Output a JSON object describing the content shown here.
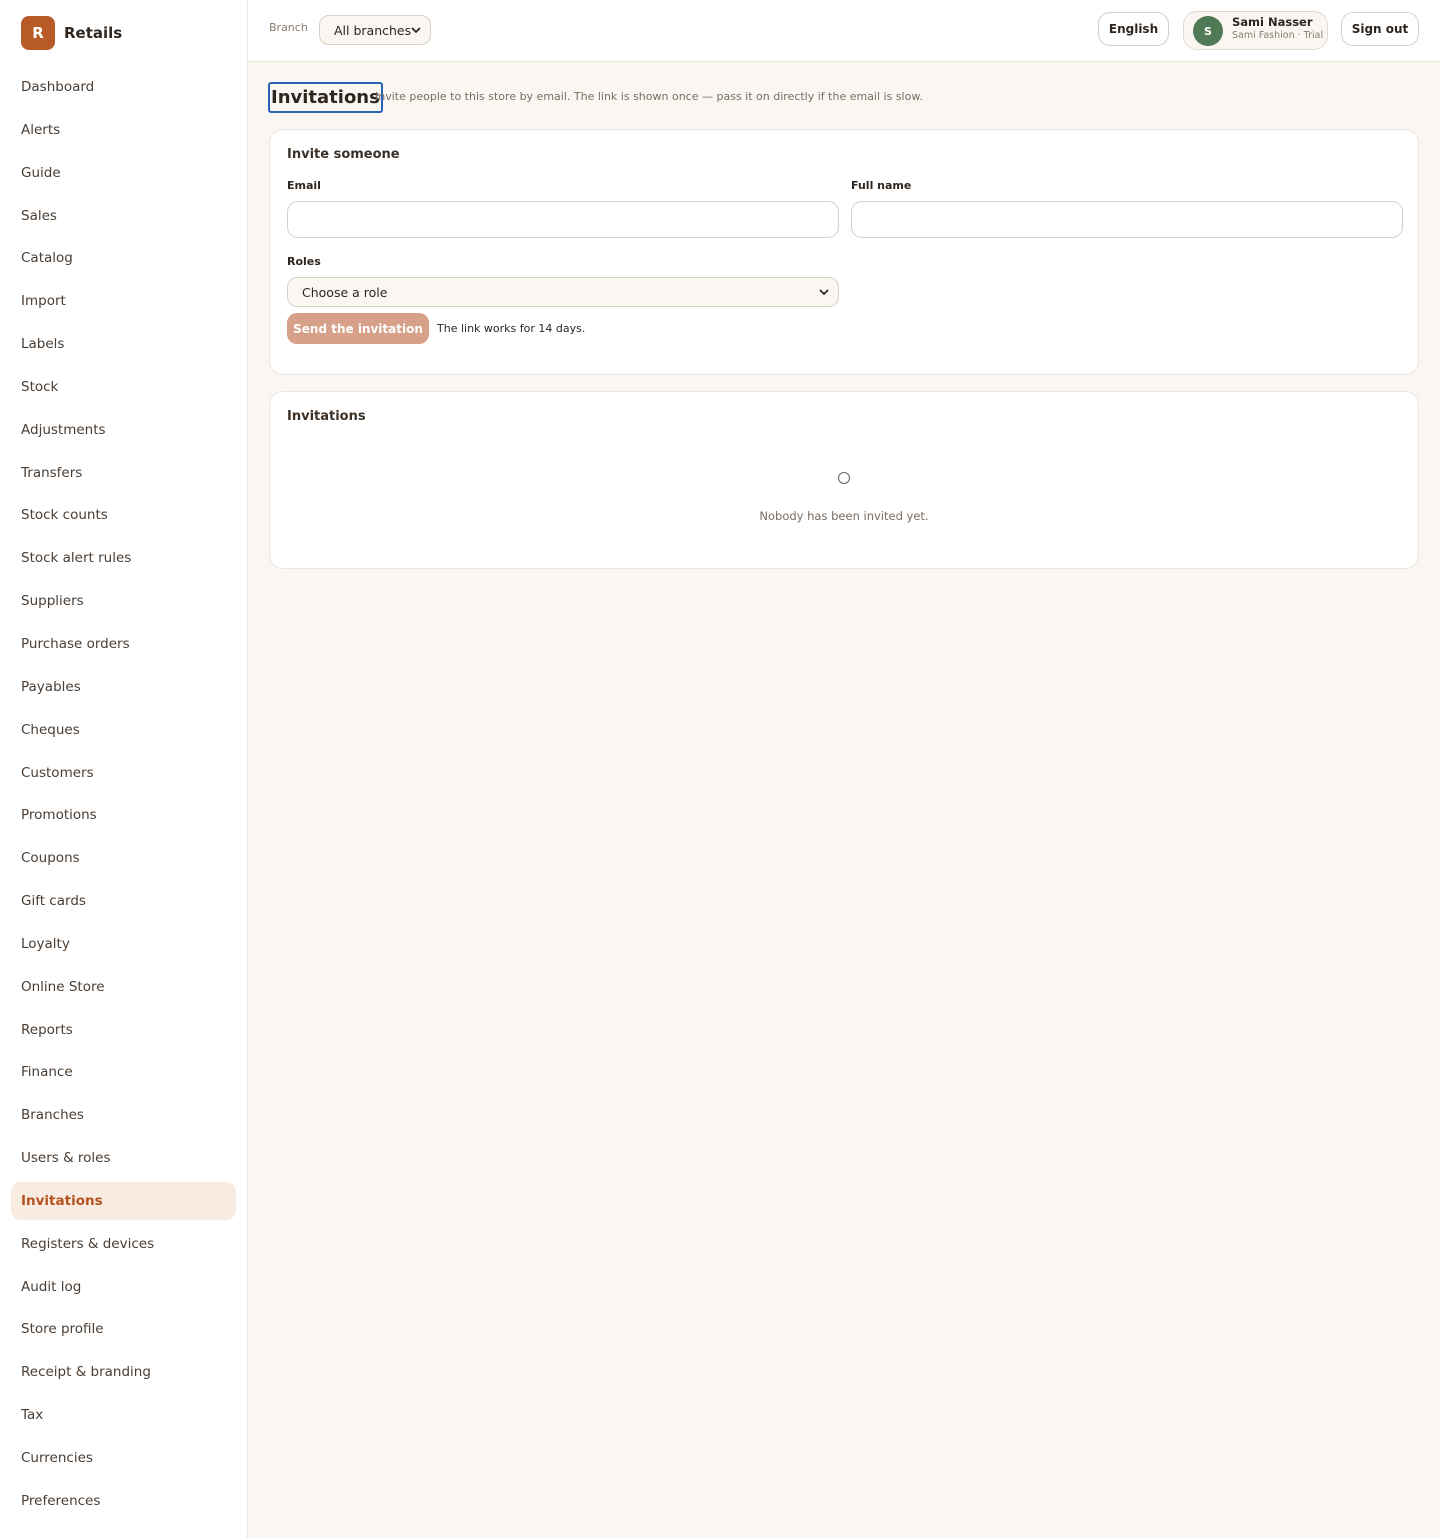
{
  "app": {
    "logo_letter": "R",
    "name": "Retails"
  },
  "sidebar": {
    "items": [
      {
        "label": "Dashboard",
        "active": false
      },
      {
        "label": "Alerts",
        "active": false
      },
      {
        "label": "Guide",
        "active": false
      },
      {
        "label": "Sales",
        "active": false
      },
      {
        "label": "Catalog",
        "active": false
      },
      {
        "label": "Import",
        "active": false
      },
      {
        "label": "Labels",
        "active": false
      },
      {
        "label": "Stock",
        "active": false
      },
      {
        "label": "Adjustments",
        "active": false
      },
      {
        "label": "Transfers",
        "active": false
      },
      {
        "label": "Stock counts",
        "active": false
      },
      {
        "label": "Stock alert rules",
        "active": false
      },
      {
        "label": "Suppliers",
        "active": false
      },
      {
        "label": "Purchase orders",
        "active": false
      },
      {
        "label": "Payables",
        "active": false
      },
      {
        "label": "Cheques",
        "active": false
      },
      {
        "label": "Customers",
        "active": false
      },
      {
        "label": "Promotions",
        "active": false
      },
      {
        "label": "Coupons",
        "active": false
      },
      {
        "label": "Gift cards",
        "active": false
      },
      {
        "label": "Loyalty",
        "active": false
      },
      {
        "label": "Online Store",
        "active": false
      },
      {
        "label": "Reports",
        "active": false
      },
      {
        "label": "Finance",
        "active": false
      },
      {
        "label": "Branches",
        "active": false
      },
      {
        "label": "Users & roles",
        "active": false
      },
      {
        "label": "Invitations",
        "active": true
      },
      {
        "label": "Registers & devices",
        "active": false
      },
      {
        "label": "Audit log",
        "active": false
      },
      {
        "label": "Store profile",
        "active": false
      },
      {
        "label": "Receipt & branding",
        "active": false
      },
      {
        "label": "Tax",
        "active": false
      },
      {
        "label": "Currencies",
        "active": false
      },
      {
        "label": "Preferences",
        "active": false
      }
    ]
  },
  "header": {
    "branch_label": "Branch",
    "branch_value": "All branches",
    "language": "English",
    "user": {
      "initial": "S",
      "name": "Sami Nasser",
      "subtitle": "Sami Fashion · Trial"
    },
    "sign_out": "Sign out"
  },
  "page": {
    "title": "Invitations",
    "subtitle": "Invite people to this store by email. The link is shown once — pass it on directly if the email is slow."
  },
  "invite_form": {
    "title": "Invite someone",
    "email_label": "Email",
    "email_value": "",
    "name_label": "Full name",
    "name_value": "",
    "roles_label": "Roles",
    "roles_value": "Choose a role",
    "send_label": "Send the invitation",
    "hint": "The link works for 14 days."
  },
  "invitations_list": {
    "title": "Invitations",
    "empty_text": "Nobody has been invited yet."
  },
  "colors": {
    "accent": "#b85a28",
    "active_bg": "#f8ebe1",
    "background": "#faf6f1",
    "avatar": "#4f7a55",
    "button_disabled": "#d6a089",
    "focus_ring": "#2b62b8"
  },
  "icons": {
    "branch_dropdown": "chevron-down-icon",
    "role_dropdown": "chevron-down-icon",
    "empty_state": "circle-icon"
  }
}
